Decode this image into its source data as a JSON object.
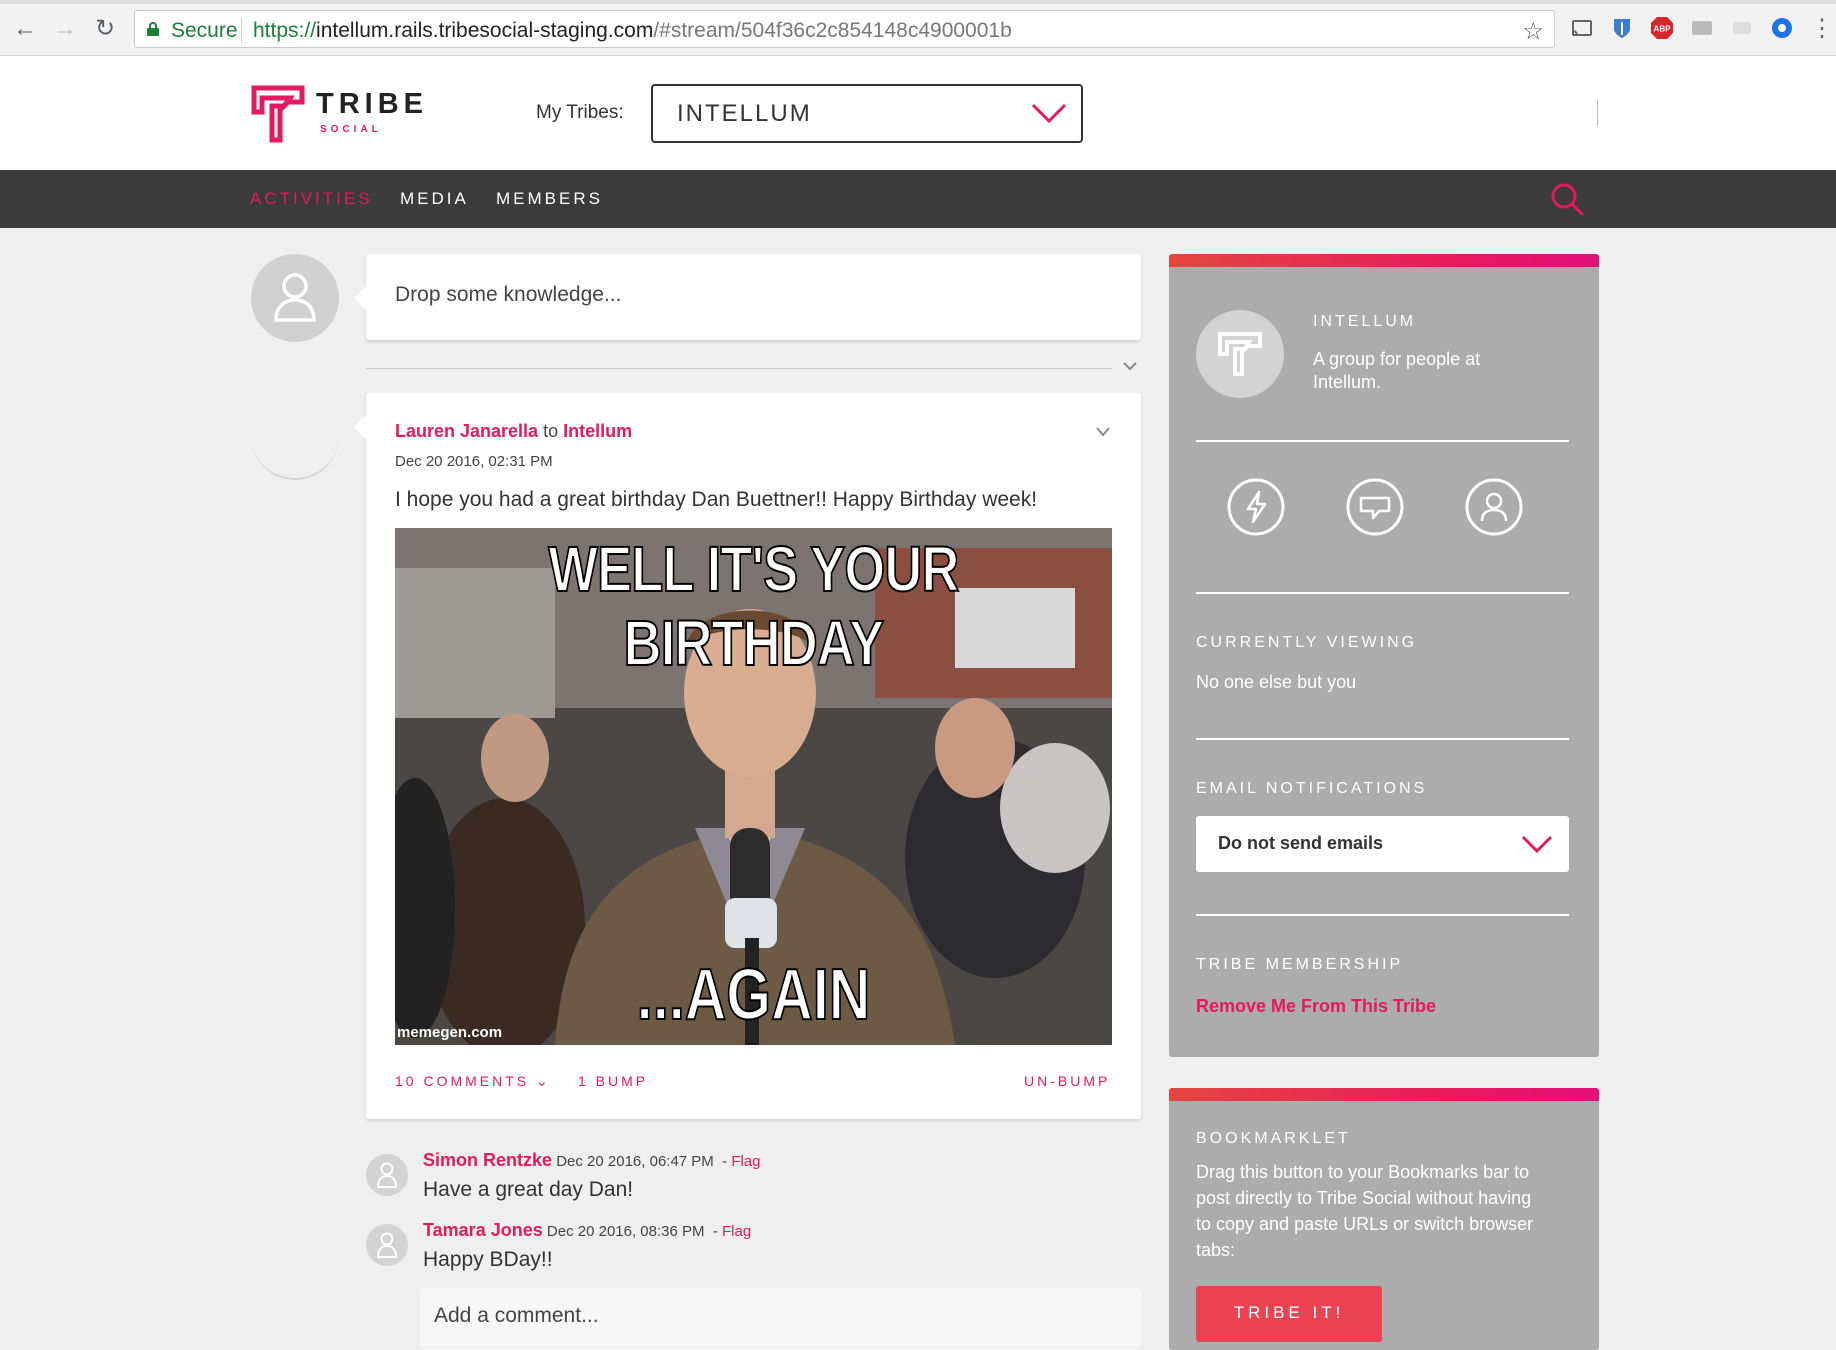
{
  "browser": {
    "secure_label": "Secure",
    "url_scheme": "https://",
    "url_host": "intellum.rails.tribesocial-staging.com",
    "url_path": "/#stream/504f36c2c854148c4900001b"
  },
  "header": {
    "logo_word": "TRIBE",
    "logo_sub": "SOCIAL",
    "my_tribes_label": "My Tribes:",
    "selected_tribe": "INTELLUM"
  },
  "nav": {
    "items": [
      "ACTIVITIES",
      "MEDIA",
      "MEMBERS"
    ],
    "active": "ACTIVITIES"
  },
  "composer": {
    "placeholder": "Drop some knowledge..."
  },
  "post": {
    "author": "Lauren Janarella",
    "to_word": "to",
    "target": "Intellum",
    "date": "Dec 20 2016, 02:31 PM",
    "text": "I hope you had a great birthday Dan Buettner!! Happy Birthday week!",
    "meme_top": "WELL IT'S YOUR BIRTHDAY",
    "meme_bottom": "...AGAIN",
    "meme_watermark": "memegen.com",
    "comments_label": "10 COMMENTS",
    "bump_label": "1 BUMP",
    "unbump_label": "UN-BUMP"
  },
  "comments": [
    {
      "name": "Simon Rentzke",
      "date": "Dec 20 2016, 06:47 PM",
      "flag": "Flag",
      "text": "Have a great day Dan!"
    },
    {
      "name": "Tamara Jones",
      "date": "Dec 20 2016, 08:36 PM",
      "flag": "Flag",
      "text": "Happy BDay!!"
    }
  ],
  "add_comment_placeholder": "Add a comment...",
  "sidebar": {
    "tribe_name": "INTELLUM",
    "tribe_desc_line1": "A group for people at",
    "tribe_desc_line2": "Intellum.",
    "icons": [
      "activity-icon",
      "chat-icon",
      "member-icon"
    ],
    "currently_viewing_header": "CURRENTLY VIEWING",
    "currently_viewing_text": "No one else but you",
    "email_header": "EMAIL NOTIFICATIONS",
    "email_selected": "Do not send emails",
    "membership_header": "TRIBE MEMBERSHIP",
    "remove_link": "Remove Me From This Tribe",
    "bookmarklet_header": "BOOKMARKLET",
    "bookmarklet_lines": [
      "Drag this button to your Bookmarks bar to",
      "post directly to Tribe Social without having",
      "to copy and paste URLs or switch browser",
      "tabs:"
    ],
    "tribe_it_label": "TRIBE IT!"
  },
  "colors": {
    "accent": "#e5195f",
    "navbar": "#3b3b3b",
    "sidebar": "#acacac"
  }
}
